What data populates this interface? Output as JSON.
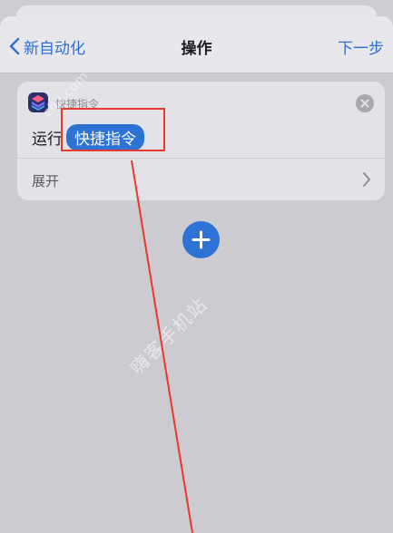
{
  "nav": {
    "back_label": "新自动化",
    "title": "操作",
    "next_label": "下一步"
  },
  "action_card": {
    "app_name": "快捷指令",
    "verb": "运行",
    "token": "快捷指令",
    "expand_label": "展开",
    "icons": {
      "app": "shortcuts-app-icon",
      "remove": "remove-circle-icon",
      "expand": "chevron-right-icon"
    }
  },
  "add_button": {
    "icon": "plus-icon"
  },
  "watermark": {
    "text": "嗨客手机站",
    "url": "cha.com"
  },
  "annotation": {
    "color": "#e53a2c"
  },
  "colors": {
    "accent": "#2d73d6",
    "link": "#2e6fd1"
  }
}
